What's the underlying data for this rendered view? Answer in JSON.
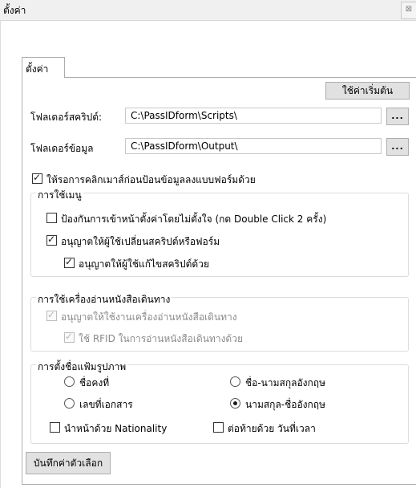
{
  "window": {
    "title": "ตั้งค่า",
    "close_glyph": "⊠"
  },
  "tab": {
    "label": "ตั้งค่า"
  },
  "toolbar": {
    "defaults_label": "ใช้ค่าเริ่มต้น"
  },
  "script_folder": {
    "label": "โฟลเดอร์สคริปต์:",
    "value": "C:\\PassIDform\\Scripts\\",
    "browse_label": "..."
  },
  "data_folder": {
    "label": "โฟลเดอร์ข้อมูล",
    "value": "C:\\PassIDform\\Output\\",
    "browse_label": "..."
  },
  "click_before_fill": {
    "label": "ให้รอการคลิกเมาส์ก่อนป้อนข้อมูลลงแบบฟอร์มด้วย",
    "checked": true
  },
  "menu_group": {
    "title": "การใช้เมนู",
    "prevent_settings": {
      "label": "ป้องกันการเข้าหน้าตั้งค่าโดยไม่ตั้งใจ (กด Double Click 2 ครั้ง)",
      "checked": false
    },
    "allow_change_script": {
      "label": "อนุญาตให้ผู้ใช้เปลี่ยนสคริปต์หรือฟอร์ม",
      "checked": true
    },
    "allow_edit_script": {
      "label": "อนุญาตให้ผู้ใช้แก้ไขสคริปต์ด้วย",
      "checked": true
    }
  },
  "passport_group": {
    "title": "การใช้เครื่องอ่านหนังสือเดินทาง",
    "allow_reader": {
      "label": "อนุญาตให้ใช้งานเครื่องอ่านหนังสือเดินทาง",
      "checked": true,
      "disabled": true
    },
    "use_rfid": {
      "label": "ใช้ RFID ในการอ่านหนังสือเดินทางด้วย",
      "checked": true,
      "disabled": true
    }
  },
  "filename_group": {
    "title": "การตั้งชื่อแฟ้มรูปภาพ",
    "options": [
      {
        "label": "ชื่อคงที่",
        "selected": false
      },
      {
        "label": "ชื่อ-นามสกุลอังกฤษ",
        "selected": false
      },
      {
        "label": "เลขที่เอกสาร",
        "selected": false
      },
      {
        "label": "นามสกุล-ชื่ออังกฤษ",
        "selected": true
      }
    ],
    "prefix_nationality": {
      "label": "นำหน้าด้วย Nationality",
      "checked": false
    },
    "suffix_datetime": {
      "label": "ต่อท้ายด้วย วันที่เวลา",
      "checked": false
    }
  },
  "save_label": "บันทึกค่าตัวเลือก"
}
